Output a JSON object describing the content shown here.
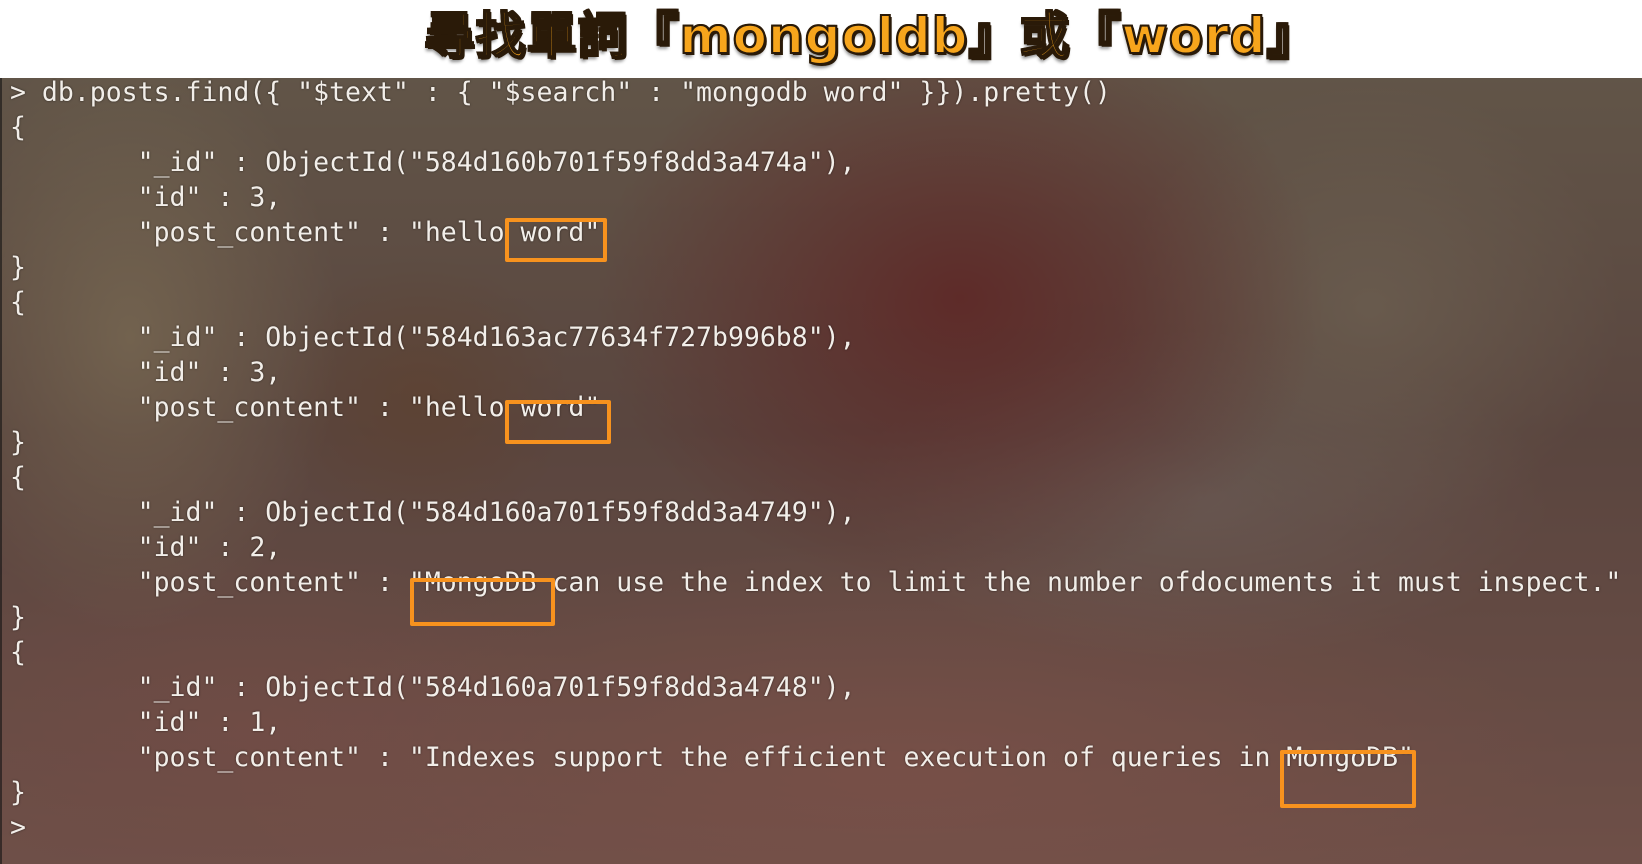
{
  "title": "尋找單詞『mongoldb』或『word』",
  "terminal": {
    "lines": [
      "> db.posts.find({ \"$text\" : { \"$search\" : \"mongodb word\" }}).pretty()",
      "{",
      "        \"_id\" : ObjectId(\"584d160b701f59f8dd3a474a\"),",
      "        \"id\" : 3,",
      "        \"post_content\" : \"hello word\"",
      "}",
      "{",
      "        \"_id\" : ObjectId(\"584d163ac77634f727b996b8\"),",
      "        \"id\" : 3,",
      "        \"post_content\" : \"hello word\"",
      "}",
      "{",
      "        \"_id\" : ObjectId(\"584d160a701f59f8dd3a4749\"),",
      "        \"id\" : 2,",
      "        \"post_content\" : \"MongoDB can use the index to limit the number ofdocuments it must inspect.\"",
      "}",
      "{",
      "        \"_id\" : ObjectId(\"584d160a701f59f8dd3a4748\"),",
      "        \"id\" : 1,",
      "        \"post_content\" : \"Indexes support the efficient execution of queries in MongoDB\"",
      "}",
      ">"
    ]
  },
  "colors": {
    "title_fill": "#f7a51c",
    "highlight_border": "#f7921e",
    "terminal_text": "#f2eee9"
  }
}
